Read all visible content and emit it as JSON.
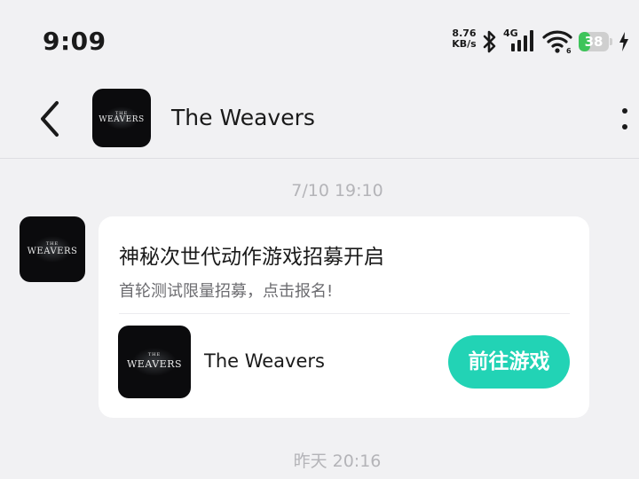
{
  "status_bar": {
    "time": "9:09",
    "net_speed_value": "8.76",
    "net_speed_unit": "KB/s",
    "network_type": "4G",
    "wifi_sub": "6",
    "battery_level": "38",
    "battery_fraction": 0.38,
    "battery_color": "#3ec45a"
  },
  "header": {
    "title": "The Weavers",
    "back_icon": "chevron-left-icon",
    "more_icon": "more-vertical-icon"
  },
  "logo": {
    "small": "THE",
    "main": "WEAVERS"
  },
  "messages": [
    {
      "timestamp": "7/10  19:10",
      "card": {
        "title": "神秘次世代动作游戏招募开启",
        "subtitle": "首轮测试限量招募，点击报名!",
        "game_name": "The Weavers",
        "button_label": "前往游戏",
        "button_color": "#22d3b5"
      }
    }
  ],
  "next_timestamp": "昨天  20:16"
}
